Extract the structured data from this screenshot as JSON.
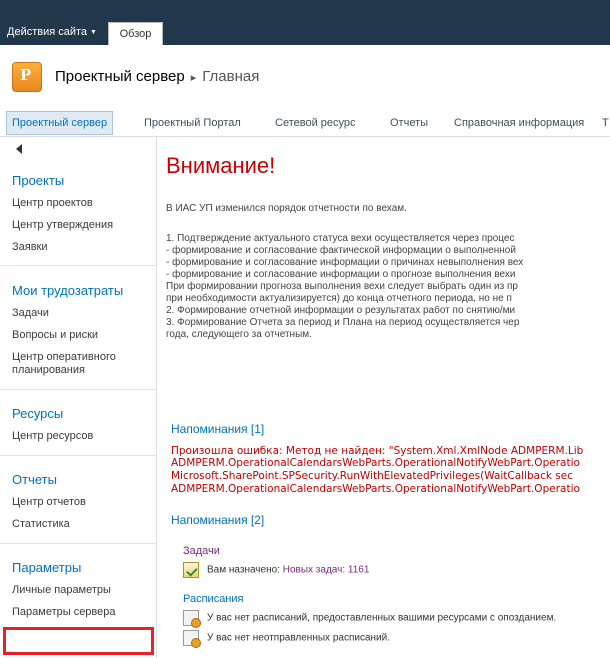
{
  "ribbon": {
    "site_actions": "Действия сайта",
    "browse_tab": "Обзор"
  },
  "title": {
    "logo_glyph": "P",
    "site": "Проектный сервер",
    "separator": "▸",
    "current": "Главная"
  },
  "topnav": {
    "items": [
      "Проектный сервер",
      "Проектный Портал",
      "Сетевой ресурс",
      "Отчеты",
      "Справочная информация",
      "Т"
    ]
  },
  "leftnav": {
    "projects": {
      "title": "Проекты",
      "items": [
        "Центр проектов",
        "Центр утверждения",
        "Заявки"
      ]
    },
    "timesheets": {
      "title": "Мои трудозатраты",
      "items": [
        "Задачи",
        "Вопросы и риски",
        "Центр оперативного планирования"
      ]
    },
    "resources": {
      "title": "Ресурсы",
      "items": [
        "Центр ресурсов"
      ]
    },
    "reports": {
      "title": "Отчеты",
      "items": [
        "Центр отчетов",
        "Статистика"
      ]
    },
    "settings": {
      "title": "Параметры",
      "items": [
        "Личные параметры",
        "Параметры сервера"
      ]
    }
  },
  "main": {
    "warning_title": "Внимание!",
    "intro": "В ИАС УП изменился порядок отчетности по вехам.",
    "lines": [
      "1. Подтверждение актуального статуса вехи осуществляется через процес",
      "- формирование и согласование фактической информации о выполненной",
      "- формирование и согласование информации о причинах невыполнения вех",
      "- формирование и согласование информации о прогнозе выполнения вехи",
      "При формировании прогноза выполнения вехи следует выбрать один из пр",
      "при необходимости актуализируется) до конца отчетного периода, но не п",
      "2. Формирование отчетной информации о результатах работ по снятию/ми",
      "3. Формирование Отчета за период и Плана на период осуществляется чер",
      "года, следующего за отчетным."
    ],
    "reminders1": {
      "title": "Напоминания [1]",
      "errors": [
        "Произошла ошибка: Метод не найден: \"System.Xml.XmlNode ADMPERM.Lib",
        "ADMPERM.OperationalCalendarsWebParts.OperationalNotifyWebPart.Operatio",
        "Microsoft.SharePoint.SPSecurity.RunWithElevatedPrivileges(WaitCallback sec",
        "ADMPERM.OperationalCalendarsWebParts.OperationalNotifyWebPart.Operatio"
      ]
    },
    "reminders2": {
      "title": "Напоминания [2]",
      "tasks_title": "Задачи",
      "tasks_text": "Вам назначено:",
      "tasks_link": "Новых задач: 1161",
      "schedules_title": "Расписания",
      "schedule_rows": [
        "У вас нет расписаний, предоставленных вашими ресурсами с опозданием.",
        "У вас нет неотправленных расписаний."
      ]
    }
  }
}
